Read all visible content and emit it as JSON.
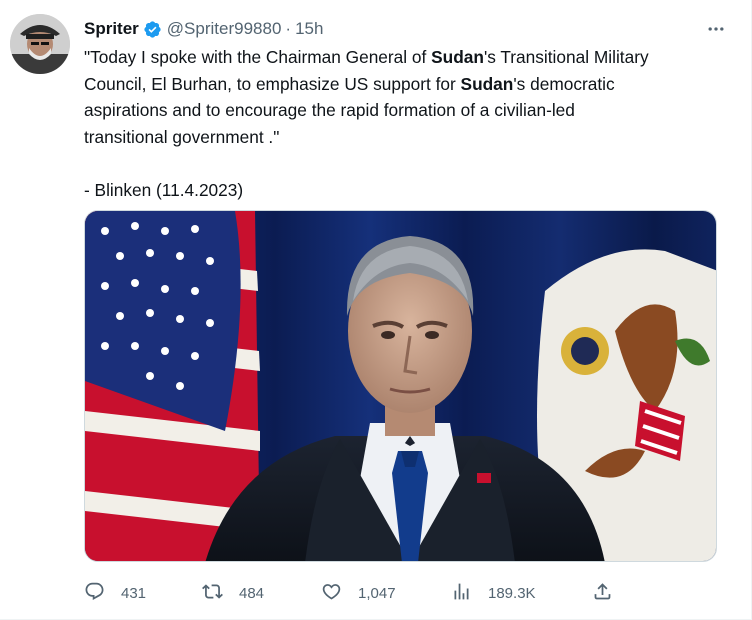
{
  "author": {
    "name": "Spriter",
    "handle": "@Spriter99880",
    "separator": "·",
    "time": "15h"
  },
  "tweet": {
    "line1_a": "\"Today I spoke with the Chairman General of ",
    "line1_b": "Sudan",
    "line1_c": "'s Transitional Military",
    "line2_a": "Council, El Burhan, to emphasize US support for ",
    "line2_b": "Sudan",
    "line2_c": "'s democratic",
    "line3": "aspirations and to encourage the rapid formation of a civilian-led",
    "line4": "transitional government .\"",
    "attribution": "- Blinken (11.4.2023)"
  },
  "metrics": {
    "replies": "431",
    "retweets": "484",
    "likes": "1,047",
    "views": "189.3K"
  },
  "colors": {
    "verified": "#1d9bf0",
    "secondary_text": "#536471",
    "primary_text": "#0f1419"
  },
  "icons": [
    "verified-badge-icon",
    "more-icon",
    "reply-icon",
    "retweet-icon",
    "like-icon",
    "views-icon",
    "share-icon"
  ]
}
